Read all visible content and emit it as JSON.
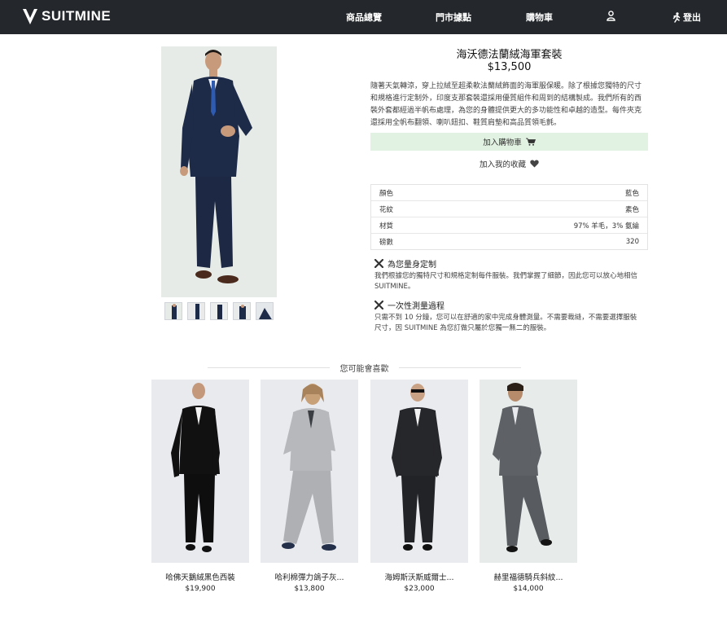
{
  "header": {
    "brand": "SUITMINE",
    "nav": {
      "products": "商品總覽",
      "stores": "門市據點",
      "cart": "購物車",
      "logout": "登出"
    }
  },
  "product": {
    "title": "海沃德法蘭絨海軍套裝",
    "price": "$13,500",
    "description": "隨著天氣轉涼，穿上拉絨至超柔軟法蘭絨飾面的海軍服保暖。除了根據您獨特的尺寸和規格進行定制外，印度支那套裝還採用優質組件和周到的結構製成。我們所有的西裝外套都經過半帆布處理，為您的身體提供更大的多功能性和卓越的造型。每件夾克還採用全帆布翻領、喇叭鈕扣、鞋質肩墊和高品質領毛氈。",
    "add_to_cart": "加入購物車",
    "add_to_fav": "加入我的收藏",
    "specs": [
      {
        "label": "顏色",
        "value": "藍色"
      },
      {
        "label": "花紋",
        "value": "素色"
      },
      {
        "label": "材質",
        "value": "97% 羊毛，3% 氨綸"
      },
      {
        "label": "磅數",
        "value": "320"
      }
    ],
    "features": [
      {
        "title": "為您量身定制",
        "text": "我們根據您的獨特尺寸和規格定制每件服裝。我們掌握了細節，因此您可以放心地相信 SUITMINE。"
      },
      {
        "title": "一次性測量過程",
        "text": "只需不到 10 分鐘，您可以在舒適的家中完成身體測量。不需要裁縫，不需要選擇服裝尺寸，因 SUITMINE 為您訂做只屬於您獨一無二的服裝。"
      }
    ]
  },
  "recommend": {
    "title": "您可能會喜歡",
    "items": [
      {
        "name": "哈佛天鵝絨黑色西裝",
        "price": "$19,900"
      },
      {
        "name": "哈利棉彈力鴿子灰...",
        "price": "$13,800"
      },
      {
        "name": "海姆斯沃斯威爾士...",
        "price": "$23,000"
      },
      {
        "name": "赫里福德騎兵斜紋...",
        "price": "$14,000"
      }
    ]
  },
  "colors": {
    "header_bg": "#24282c",
    "cart_btn_bg": "#e2f2e2"
  },
  "icons": [
    "user-icon",
    "run-icon",
    "cart-icon",
    "heart-icon",
    "tools-icon"
  ]
}
